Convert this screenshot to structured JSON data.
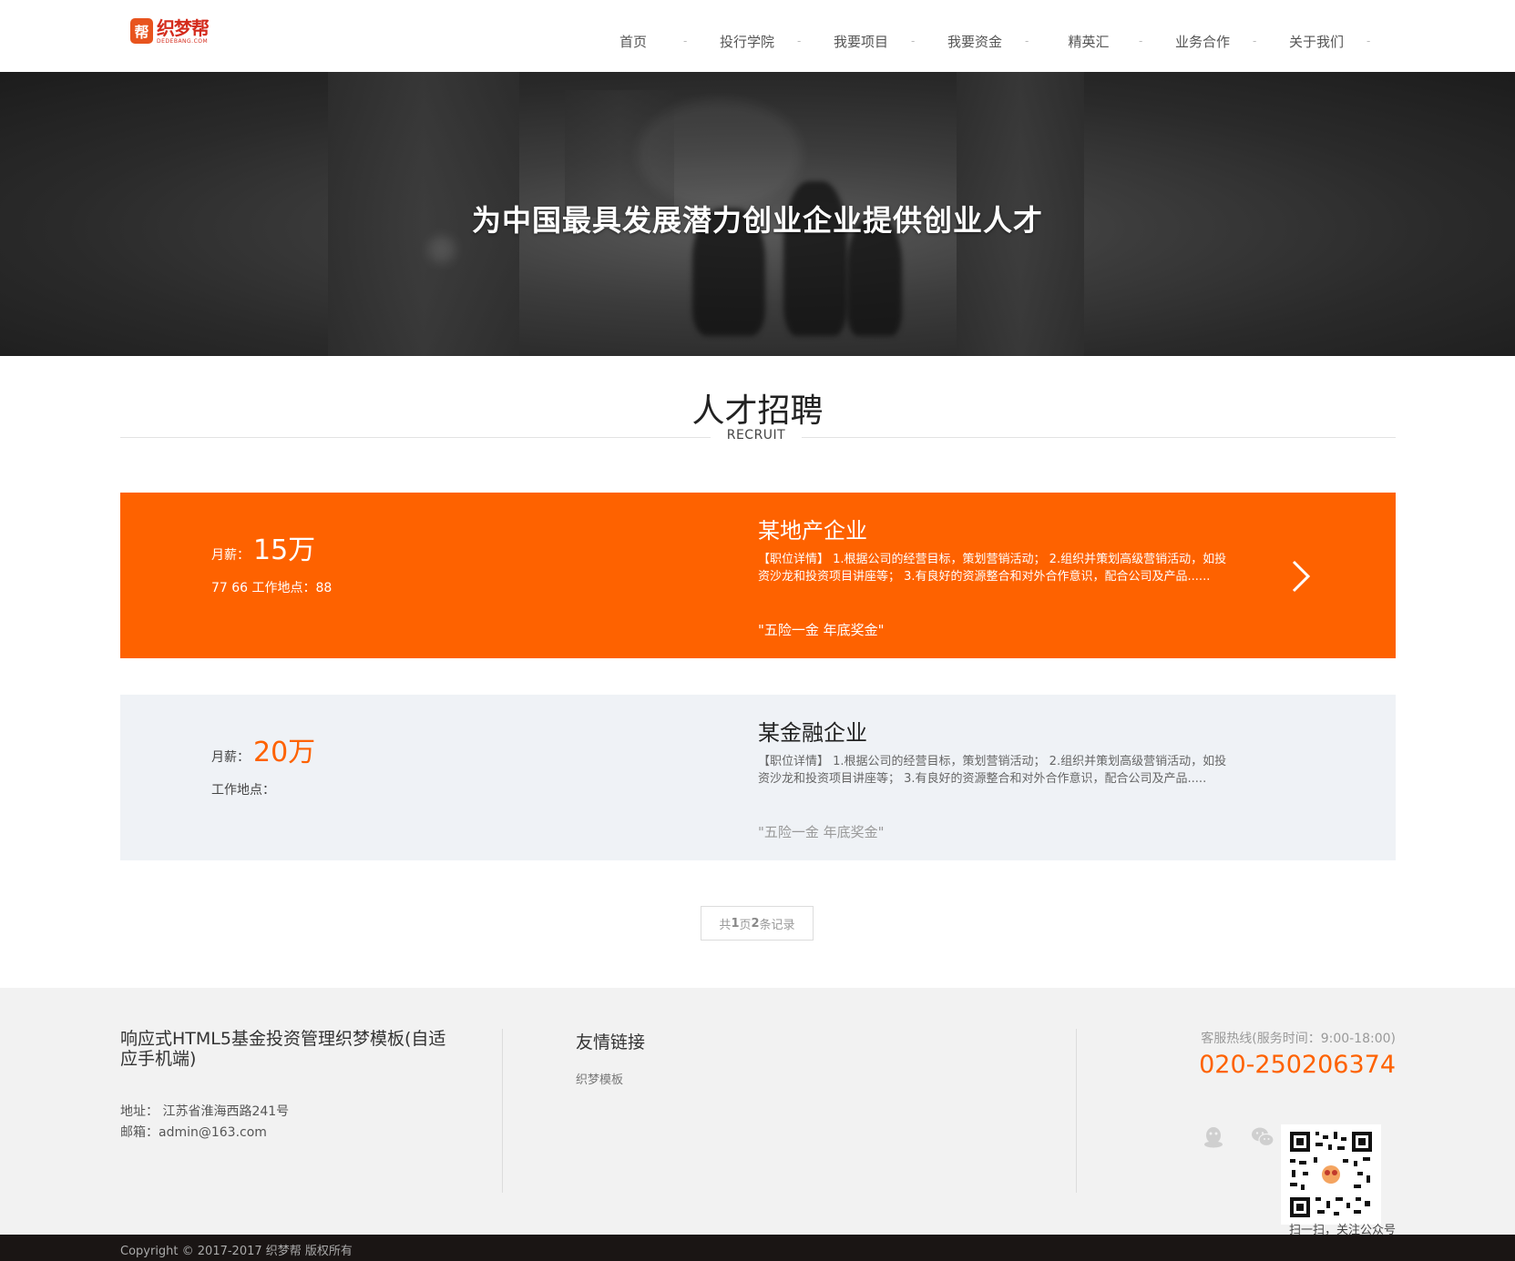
{
  "header": {
    "logo_glyph": "帮",
    "logo_name": "织梦帮",
    "logo_sub": "DEDEBANG.COM",
    "nav": [
      {
        "label": "首页",
        "sep": "-"
      },
      {
        "label": "投行学院",
        "sep": "-"
      },
      {
        "label": "我要项目",
        "sep": "-"
      },
      {
        "label": "我要资金",
        "sep": "-"
      },
      {
        "label": "精英汇",
        "sep": "-"
      },
      {
        "label": "业务合作",
        "sep": "-"
      },
      {
        "label": "关于我们",
        "sep": "-"
      }
    ]
  },
  "banner": {
    "title": "为中国最具发展潜力创业企业提供创业人才"
  },
  "section": {
    "title": "人才招聘",
    "subtitle": "RECRUIT"
  },
  "jobs": [
    {
      "salary_label": "月薪：",
      "salary": "15万",
      "location": "77 66 工作地点：88",
      "company": "某地产企业",
      "description": "【职位详情】 1.根据公司的经营目标，策划营销活动； 2.组织并策划高级营销活动，如投资沙龙和投资项目讲座等； 3.有良好的资源整合和对外合作意识，配合公司及产品......",
      "benefit": "\"五险一金 年底奖金\""
    },
    {
      "salary_label": "月薪：",
      "salary": "20万",
      "location": "工作地点：",
      "company": "某金融企业",
      "description": "【职位详情】 1.根据公司的经营目标，策划营销活动； 2.组织并策划高级营销活动，如投资沙龙和投资项目讲座等； 3.有良好的资源整合和对外合作意识，配合公司及产品.....",
      "benefit": "\"五险一金 年底奖金\""
    }
  ],
  "pager": {
    "prefix": "共 ",
    "pages": "1",
    "mid": "页",
    "records": "2",
    "suffix": "条记录"
  },
  "footer": {
    "site_name": "响应式HTML5基金投资管理织梦模板(自适应手机端)",
    "address": "地址： 江苏省淮海西路241号",
    "email": "邮箱：admin@163.com",
    "links_title": "友情链接",
    "links": [
      "织梦模板"
    ],
    "hotline_label": "客服热线(服务时间：9:00-18:00)",
    "hotline": "020-250206374",
    "qr_caption": "扫一扫，关注公众号"
  },
  "copyright": "Copyright © 2017-2017 织梦帮 版权所有",
  "colors": {
    "accent": "#fe6200",
    "card_bg": "#eff2f6",
    "footer_bg": "#f2f2f2",
    "copyright_bg": "#1a1514"
  }
}
